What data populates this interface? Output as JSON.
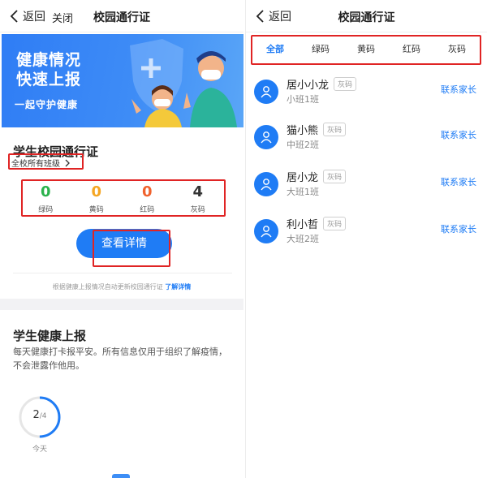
{
  "left": {
    "nav": {
      "back_label": "返回",
      "close_label": "关闭",
      "title": "校园通行证"
    },
    "banner": {
      "line1": "健康情况",
      "line2": "快速上报",
      "slogan": "一起守护健康"
    },
    "pass": {
      "title": "学生校园通行证",
      "scope": "全校所有班级",
      "stats": [
        {
          "value": "0",
          "label": "绿码",
          "color": "#2bb24c"
        },
        {
          "value": "0",
          "label": "黄码",
          "color": "#f5a623"
        },
        {
          "value": "0",
          "label": "红码",
          "color": "#f0622d"
        },
        {
          "value": "4",
          "label": "灰码",
          "color": "#333333"
        }
      ],
      "detail_button": "查看详情",
      "note": "根据健康上报情况自动更新校园通行证",
      "note_link": "了解详情"
    },
    "health": {
      "title": "学生健康上报",
      "desc": "每天健康打卡报平安。所有信息仅用于组织了解疫情，不会泄露作他用。",
      "progress_done": "2",
      "progress_total": "/4",
      "progress_fraction": 0.5,
      "today": "今天"
    }
  },
  "right": {
    "nav": {
      "back_label": "返回",
      "title": "校园通行证"
    },
    "tabs": [
      {
        "label": "全部"
      },
      {
        "label": "绿码"
      },
      {
        "label": "黄码"
      },
      {
        "label": "红码"
      },
      {
        "label": "灰码"
      }
    ],
    "students": [
      {
        "name": "居小小龙",
        "badge": "灰码",
        "class": "小班1班",
        "action": "联系家长"
      },
      {
        "name": "猫小熊",
        "badge": "灰码",
        "class": "中班2班",
        "action": "联系家长"
      },
      {
        "name": "居小龙",
        "badge": "灰码",
        "class": "大班1班",
        "action": "联系家长"
      },
      {
        "name": "利小哲",
        "badge": "灰码",
        "class": "大班2班",
        "action": "联系家长"
      }
    ]
  },
  "colors": {
    "accent": "#1f7cf5",
    "highlight": "#e02424",
    "banner": "#3e8cf6"
  }
}
